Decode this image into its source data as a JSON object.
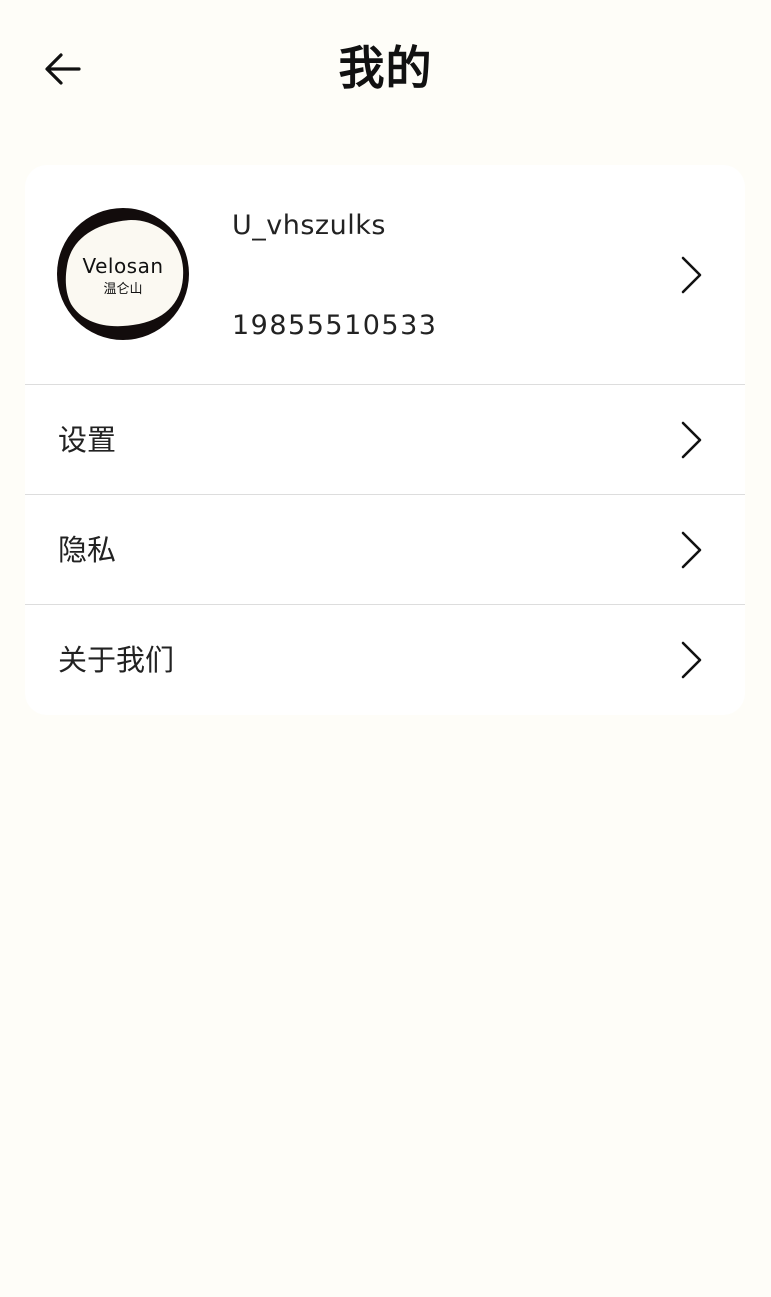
{
  "header": {
    "title": "我的",
    "back_icon": "arrow-left-icon"
  },
  "profile": {
    "avatar_logo_text": "Velosan",
    "avatar_logo_subtext": "温仑山",
    "username": "U_vhszulks",
    "phone": "19855510533"
  },
  "menu": {
    "items": [
      {
        "label": "设置"
      },
      {
        "label": "隐私"
      },
      {
        "label": "关于我们"
      }
    ]
  },
  "colors": {
    "page_background": "#fefdf8",
    "card_background": "#ffffff",
    "divider": "#dddddd",
    "text": "#222222"
  }
}
